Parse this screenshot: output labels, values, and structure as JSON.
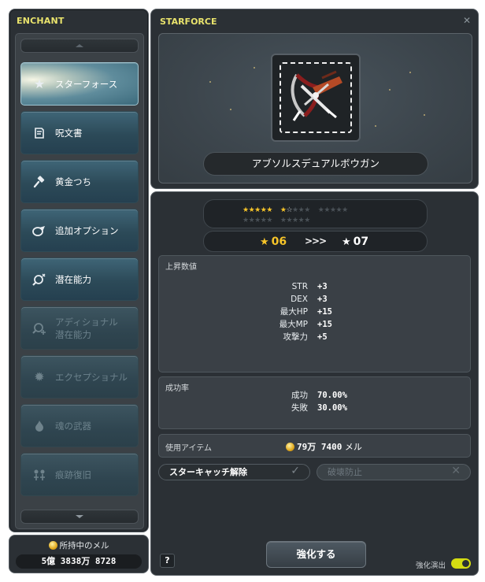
{
  "colors": {
    "title_yellow": "#e9e36c",
    "star_gold": "#f6c429",
    "panel_bg": "#2b3035",
    "toggle_on": "#d4dc12"
  },
  "enchant": {
    "title": "ENCHANT",
    "menu": [
      {
        "label": "スターフォース",
        "icon": "star-icon",
        "state": "active"
      },
      {
        "label": "呪文書",
        "icon": "scroll-icon",
        "state": "enabled"
      },
      {
        "label": "黄金つち",
        "icon": "hammer-icon",
        "state": "enabled"
      },
      {
        "label": "追加オプション",
        "icon": "flame-icon",
        "state": "enabled"
      },
      {
        "label": "潜在能力",
        "icon": "magnify-icon",
        "state": "enabled"
      },
      {
        "label": "アディショナル\n潜在能力",
        "icon": "magnify-plus-icon",
        "state": "disabled"
      },
      {
        "label": "エクセプショナル",
        "icon": "gear-icon",
        "state": "disabled"
      },
      {
        "label": "魂の武器",
        "icon": "soul-flame-icon",
        "state": "disabled"
      },
      {
        "label": "痕跡復旧",
        "icon": "trace-icon",
        "state": "disabled"
      }
    ],
    "meso_title": "所持中のメル",
    "meso_value": "5億 3838万 8728"
  },
  "starforce": {
    "title": "STARFORCE",
    "close_icon": "close-icon",
    "item_name": "アブソルスデュアルボウガン",
    "current_stars": 6,
    "max_stars_shown": 25,
    "current_level": "06",
    "next_level": "07",
    "arrows": ">>>",
    "increase_label": "上昇数値",
    "stats": [
      {
        "name": "STR",
        "value": "+3"
      },
      {
        "name": "DEX",
        "value": "+3"
      },
      {
        "name": "最大HP",
        "value": "+15"
      },
      {
        "name": "最大MP",
        "value": "+15"
      },
      {
        "name": "攻撃力",
        "value": "+5"
      }
    ],
    "success_label": "成功率",
    "success": {
      "name": "成功",
      "value": "70.00%"
    },
    "fail": {
      "name": "失敗",
      "value": "30.00%"
    },
    "use_item_label": "使用アイテム",
    "cost": "79万 7400",
    "cost_unit": "メル",
    "starcatch_label": "スターキャッチ解除",
    "destroy_protect_label": "破壊防止",
    "help_label": "?",
    "enhance_label": "強化する",
    "effects_label": "強化演出",
    "effects_on": true
  }
}
